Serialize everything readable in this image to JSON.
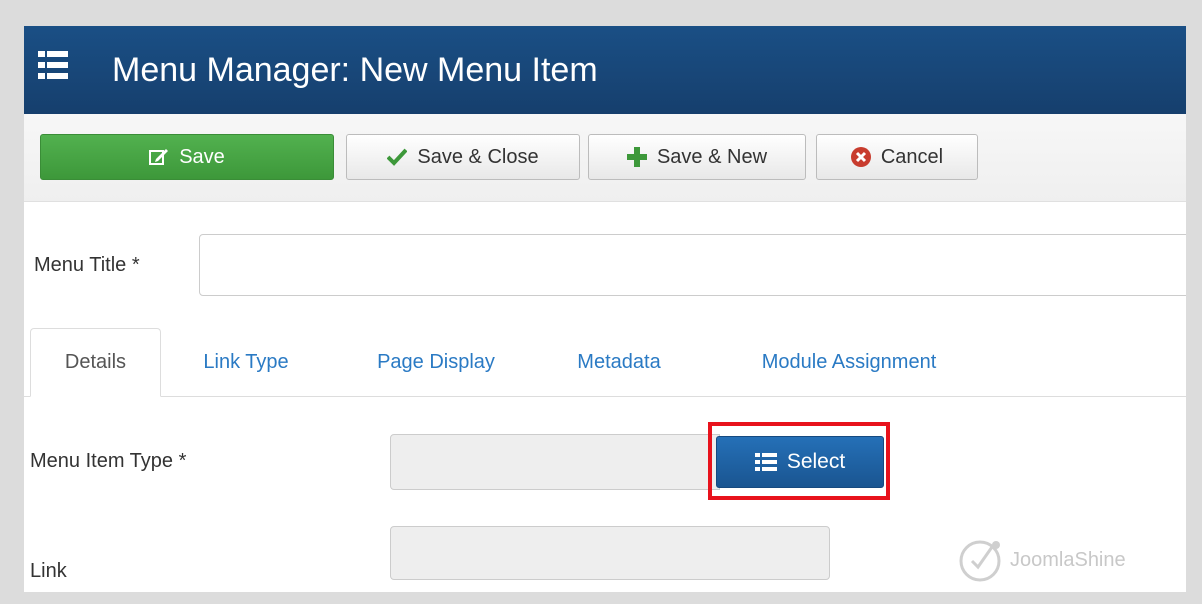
{
  "header": {
    "title": "Menu Manager: New Menu Item",
    "icon": "list-icon"
  },
  "toolbar": {
    "save_label": "Save",
    "save_close_label": "Save & Close",
    "save_new_label": "Save & New",
    "cancel_label": "Cancel"
  },
  "form": {
    "menu_title_label": "Menu Title *",
    "menu_title_value": ""
  },
  "tabs": [
    {
      "label": "Details",
      "active": true
    },
    {
      "label": "Link Type"
    },
    {
      "label": "Page Display"
    },
    {
      "label": "Metadata"
    },
    {
      "label": "Module Assignment"
    }
  ],
  "details": {
    "menu_item_type_label": "Menu Item Type *",
    "menu_item_type_value": "",
    "select_label": "Select",
    "link_label": "Link",
    "link_value": ""
  },
  "watermark": {
    "text": "JoomlaShine"
  },
  "colors": {
    "header_bg": "#1a4f85",
    "save_green": "#4aa847",
    "select_blue": "#2570b7",
    "highlight_red": "#e8121c",
    "tab_link": "#2a7ac4"
  }
}
